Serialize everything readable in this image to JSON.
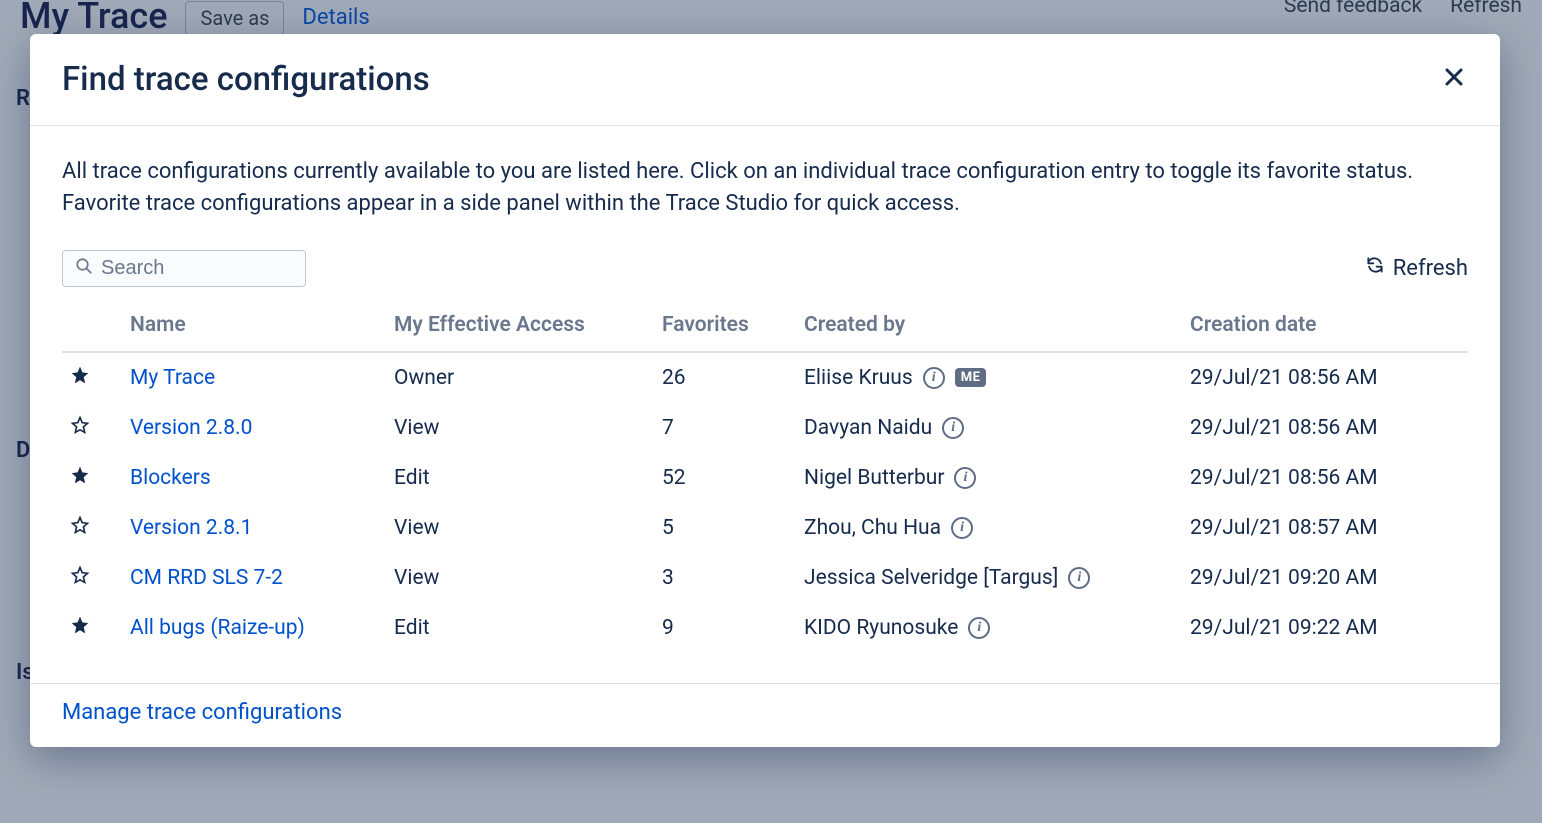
{
  "background": {
    "page_title": "My Trace",
    "save_as": "Save as",
    "details": "Details",
    "send_feedback": "Send feedback",
    "refresh": "Refresh",
    "side_labels": [
      "Re",
      "Di",
      "Is"
    ]
  },
  "modal": {
    "title": "Find trace configurations",
    "description": "All trace configurations currently available to you are listed here. Click on an individual trace configuration entry to toggle its favorite status. Favorite trace configurations appear in a side panel within the Trace Studio for quick access.",
    "search_placeholder": "Search",
    "refresh_label": "Refresh",
    "columns": {
      "name": "Name",
      "access": "My Effective Access",
      "favorites": "Favorites",
      "created_by": "Created by",
      "creation_date": "Creation date"
    },
    "me_badge": "ME",
    "rows": [
      {
        "starred": true,
        "name": "My Trace",
        "access": "Owner",
        "favorites": "26",
        "created_by": "Eliise Kruus",
        "is_me": true,
        "date": "29/Jul/21 08:56 AM"
      },
      {
        "starred": false,
        "name": "Version 2.8.0",
        "access": "View",
        "favorites": "7",
        "created_by": "Davyan Naidu",
        "is_me": false,
        "date": "29/Jul/21 08:56 AM"
      },
      {
        "starred": true,
        "name": "Blockers",
        "access": "Edit",
        "favorites": "52",
        "created_by": "Nigel Butterbur",
        "is_me": false,
        "date": "29/Jul/21 08:56 AM"
      },
      {
        "starred": false,
        "name": "Version 2.8.1",
        "access": "View",
        "favorites": "5",
        "created_by": "Zhou, Chu Hua",
        "is_me": false,
        "date": "29/Jul/21 08:57 AM"
      },
      {
        "starred": false,
        "name": "CM RRD SLS 7-2",
        "access": "View",
        "favorites": "3",
        "created_by": "Jessica Selveridge [Targus]",
        "is_me": false,
        "date": "29/Jul/21 09:20 AM"
      },
      {
        "starred": true,
        "name": "All bugs (Raize-up)",
        "access": "Edit",
        "favorites": "9",
        "created_by": "KIDO Ryunosuke",
        "is_me": false,
        "date": "29/Jul/21 09:22 AM"
      }
    ],
    "manage_link": "Manage trace configurations"
  }
}
